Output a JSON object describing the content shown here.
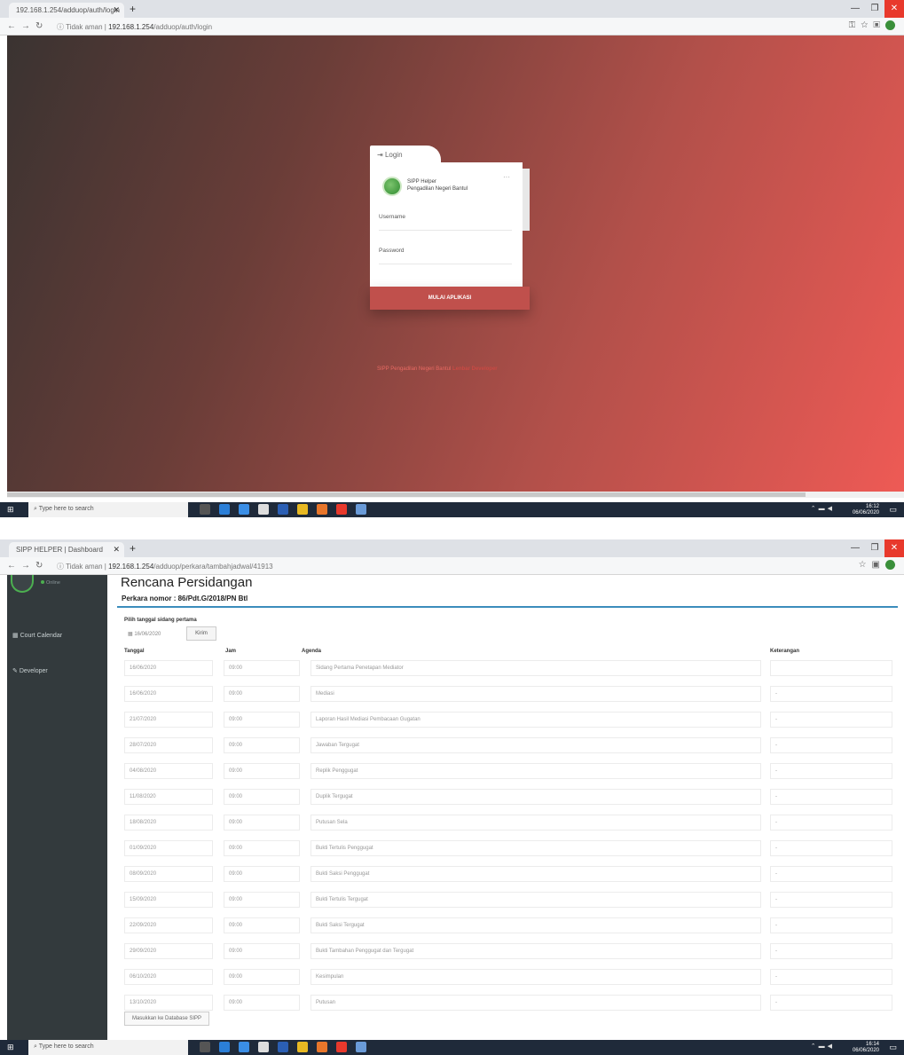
{
  "shot1": {
    "browser": {
      "tab_title": "192.168.1.254/adduop/auth/login",
      "url_secure": "Tidak aman",
      "url_host": "192.168.1.254",
      "url_path": "/adduop/auth/login"
    },
    "login": {
      "tab_label": "Login",
      "app_name": "SIPP Helper",
      "court_name": "Pengadilan Negeri Bantul",
      "username_label": "Username",
      "password_label": "Password",
      "submit_label": "MULAI APLIKASI",
      "footer_text": "SIPP Pengadilan Negeri Bantul",
      "footer_link": "Lenbar Developer"
    },
    "taskbar": {
      "search_placeholder": "Type here to search",
      "time": "16:12",
      "date": "06/06/2020"
    }
  },
  "shot2": {
    "browser": {
      "tab_title": "SIPP HELPER | Dashboard",
      "url_secure": "Tidak aman",
      "url_host": "192.168.1.254",
      "url_path": "/adduop/perkara/tambahjadwal/41913"
    },
    "sidebar": {
      "status": "Online",
      "items": [
        {
          "label": "Court Calendar"
        },
        {
          "label": "Developer"
        }
      ]
    },
    "page": {
      "title": "Rencana Persidangan",
      "case_label": "Perkara nomor : 86/Pdt.G/2018/PN Btl",
      "pick_date_label": "Pilih tanggal sidang pertama",
      "date_value": "16/06/2020",
      "send_label": "Kirim",
      "headers": {
        "tanggal": "Tanggal",
        "jam": "Jam",
        "agenda": "Agenda",
        "keterangan": "Keterangan"
      },
      "rows": [
        {
          "tanggal": "16/06/2020",
          "jam": "09:00",
          "agenda": "Sidang Pertama Penetapan Mediator",
          "keterangan": ""
        },
        {
          "tanggal": "16/06/2020",
          "jam": "09:00",
          "agenda": "Mediasi",
          "keterangan": "-"
        },
        {
          "tanggal": "21/07/2020",
          "jam": "09:00",
          "agenda": "Laporan Hasil Mediasi Pembacaan Gugatan",
          "keterangan": "-"
        },
        {
          "tanggal": "28/07/2020",
          "jam": "09:00",
          "agenda": "Jawaban Tergugat",
          "keterangan": "-"
        },
        {
          "tanggal": "04/08/2020",
          "jam": "09:00",
          "agenda": "Replik Penggugat",
          "keterangan": "-"
        },
        {
          "tanggal": "11/08/2020",
          "jam": "09:00",
          "agenda": "Duplik Tergugat",
          "keterangan": "-"
        },
        {
          "tanggal": "18/08/2020",
          "jam": "09:00",
          "agenda": "Putusan Sela",
          "keterangan": "-"
        },
        {
          "tanggal": "01/09/2020",
          "jam": "09:00",
          "agenda": "Bukti Tertulis Penggugat",
          "keterangan": "-"
        },
        {
          "tanggal": "08/09/2020",
          "jam": "09:00",
          "agenda": "Bukti Saksi Penggugat",
          "keterangan": "-"
        },
        {
          "tanggal": "15/09/2020",
          "jam": "09:00",
          "agenda": "Bukti Tertulis Tergugat",
          "keterangan": "-"
        },
        {
          "tanggal": "22/09/2020",
          "jam": "09:00",
          "agenda": "Bukti Saksi Tergugat",
          "keterangan": "-"
        },
        {
          "tanggal": "29/09/2020",
          "jam": "09:00",
          "agenda": "Bukti Tambahan Penggugat dan Tergugat",
          "keterangan": "-"
        },
        {
          "tanggal": "06/10/2020",
          "jam": "09:00",
          "agenda": "Kesimpulan",
          "keterangan": "-"
        },
        {
          "tanggal": "13/10/2020",
          "jam": "09:00",
          "agenda": "Putusan",
          "keterangan": "-"
        }
      ],
      "save_label": "Masukkan ke Database SIPP"
    },
    "taskbar": {
      "search_placeholder": "Type here to search",
      "time": "16:14",
      "date": "06/06/2020"
    }
  }
}
